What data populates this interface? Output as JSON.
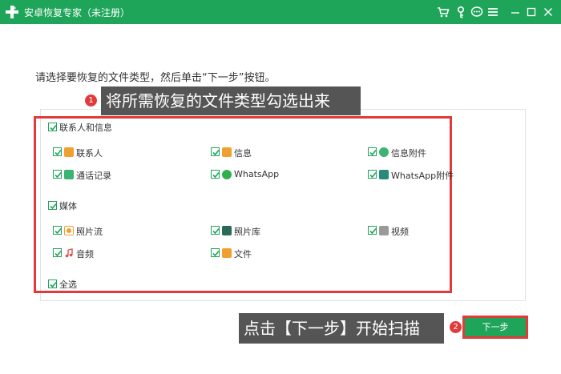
{
  "window": {
    "title": "安卓恢复专家（未注册）",
    "icons": [
      "cart-icon",
      "key-icon",
      "chat-icon",
      "menu-icon",
      "minimize-icon",
      "maximize-icon",
      "close-icon"
    ]
  },
  "instruction": "请选择要恢复的文件类型，然后单击“下一步”按钮。",
  "callouts": {
    "step1_number": "1",
    "step1_text": "将所需恢复的文件类型勾选出来",
    "step2_number": "2",
    "step2_text": "点击【下一步】开始扫描"
  },
  "groups": {
    "contacts": {
      "label": "联系人和信息",
      "items": [
        {
          "label": "联系人",
          "icon": "contact-icon",
          "color": "#f0a030"
        },
        {
          "label": "信息",
          "icon": "message-icon",
          "color": "#f0a030"
        },
        {
          "label": "信息附件",
          "icon": "attachment-icon",
          "color": "#3cb371"
        },
        {
          "label": "通话记录",
          "icon": "phone-icon",
          "color": "#3cb371"
        },
        {
          "label": "WhatsApp",
          "icon": "whatsapp-icon",
          "color": "#2fb14a"
        },
        {
          "label": "WhatsApp附件",
          "icon": "whatsapp-attachment-icon",
          "color": "#2a8a7a"
        }
      ]
    },
    "media": {
      "label": "媒体",
      "items": [
        {
          "label": "照片流",
          "icon": "photostream-icon",
          "color": "#f0a030"
        },
        {
          "label": "照片库",
          "icon": "photo-library-icon",
          "color": "#2b6a5a"
        },
        {
          "label": "视频",
          "icon": "video-icon",
          "color": "#9a9a9a"
        },
        {
          "label": "音频",
          "icon": "audio-icon",
          "color": "#e05050"
        },
        {
          "label": "文件",
          "icon": "folder-icon",
          "color": "#f0a030"
        }
      ]
    },
    "select_all": {
      "label": "全选"
    }
  },
  "buttons": {
    "next": "下一步"
  },
  "colors": {
    "brand": "#1fa55a",
    "highlight": "#e03a3a",
    "callout": "#555555"
  }
}
